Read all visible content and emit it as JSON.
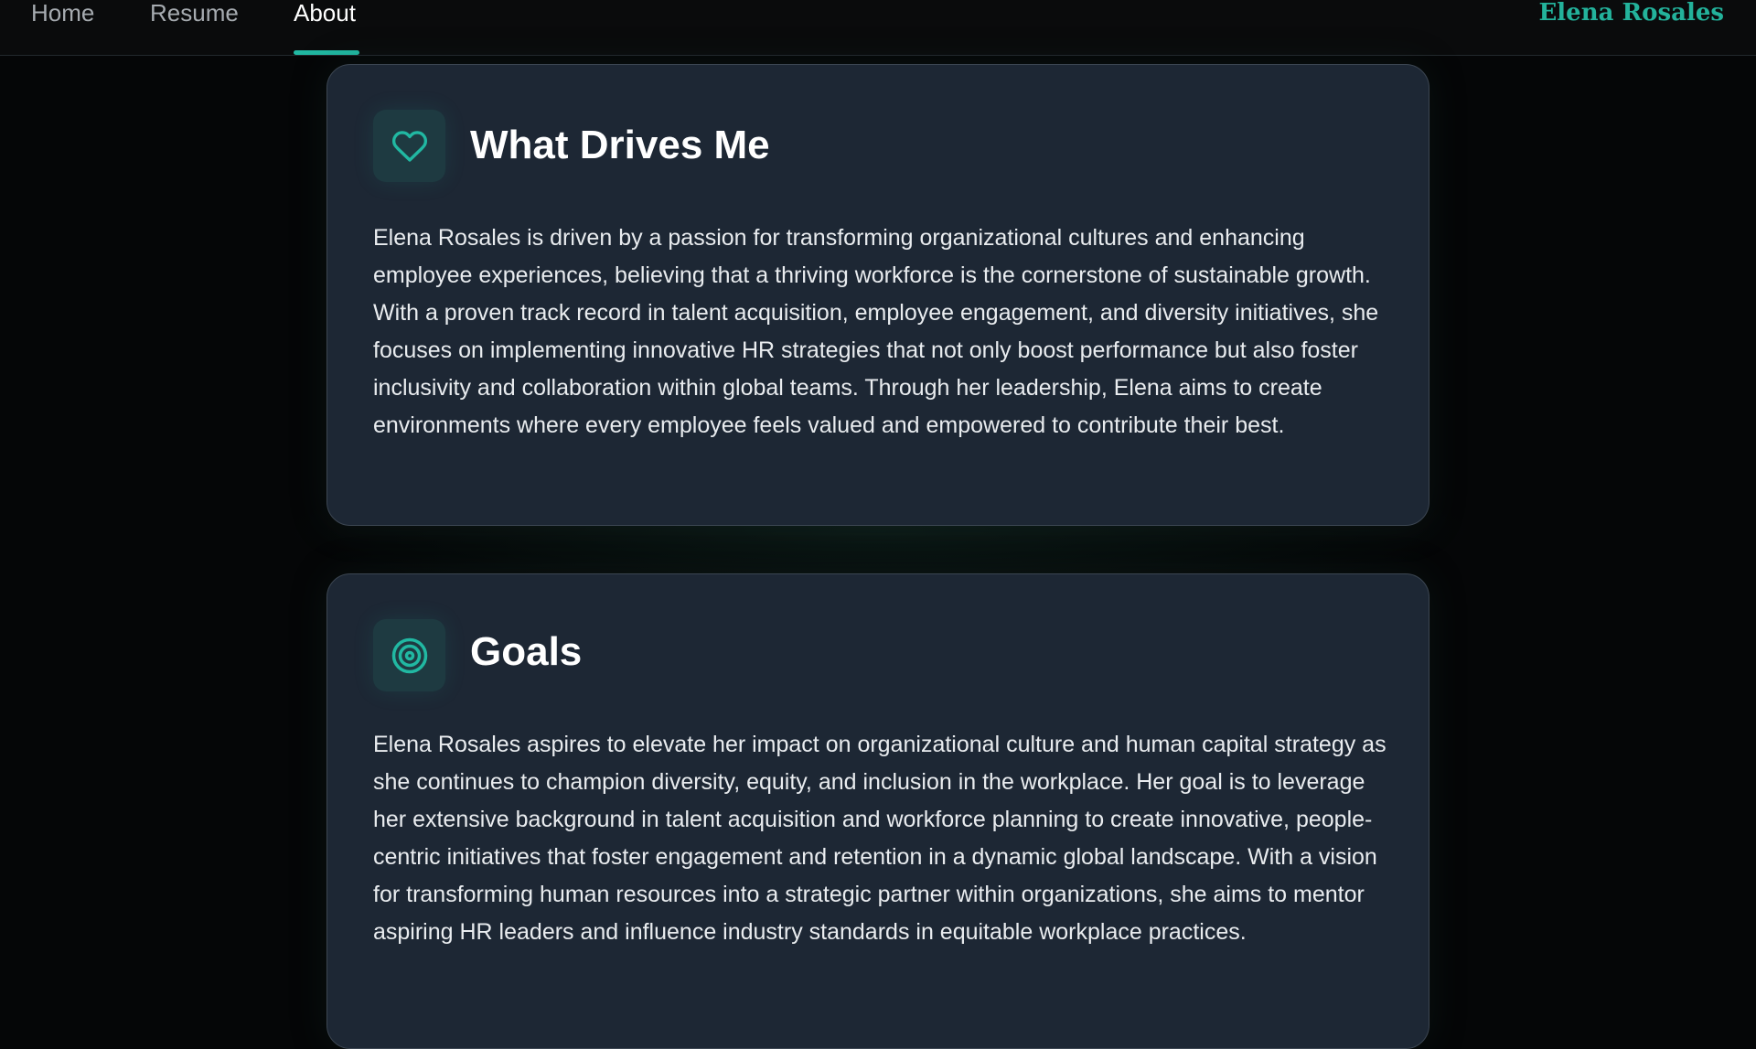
{
  "nav": {
    "items": [
      {
        "label": "Home",
        "active": false
      },
      {
        "label": "Resume",
        "active": false
      },
      {
        "label": "About",
        "active": true
      }
    ],
    "brand": "Elena Rosales"
  },
  "colors": {
    "accent": "#21b8a2",
    "background": "#050607",
    "card_background": "#1d2734",
    "icon_background": "#1e3a41",
    "text": "#e9ecef"
  },
  "sections": [
    {
      "icon": "heart-icon",
      "title": "What Drives Me",
      "body": "Elena Rosales is driven by a passion for transforming organizational cultures and enhancing employee experiences, believing that a thriving workforce is the cornerstone of sustainable growth. With a proven track record in talent acquisition, employee engagement, and diversity initiatives, she focuses on implementing innovative HR strategies that not only boost performance but also foster inclusivity and collaboration within global teams. Through her leadership, Elena aims to create environments where every employee feels valued and empowered to contribute their best."
    },
    {
      "icon": "target-icon",
      "title": "Goals",
      "body": "Elena Rosales aspires to elevate her impact on organizational culture and human capital strategy as she continues to champion diversity, equity, and inclusion in the workplace. Her goal is to leverage her extensive background in talent acquisition and workforce planning to create innovative, people-centric initiatives that foster engagement and retention in a dynamic global landscape. With a vision for transforming human resources into a strategic partner within organizations, she aims to mentor aspiring HR leaders and influence industry standards in equitable workplace practices."
    }
  ]
}
